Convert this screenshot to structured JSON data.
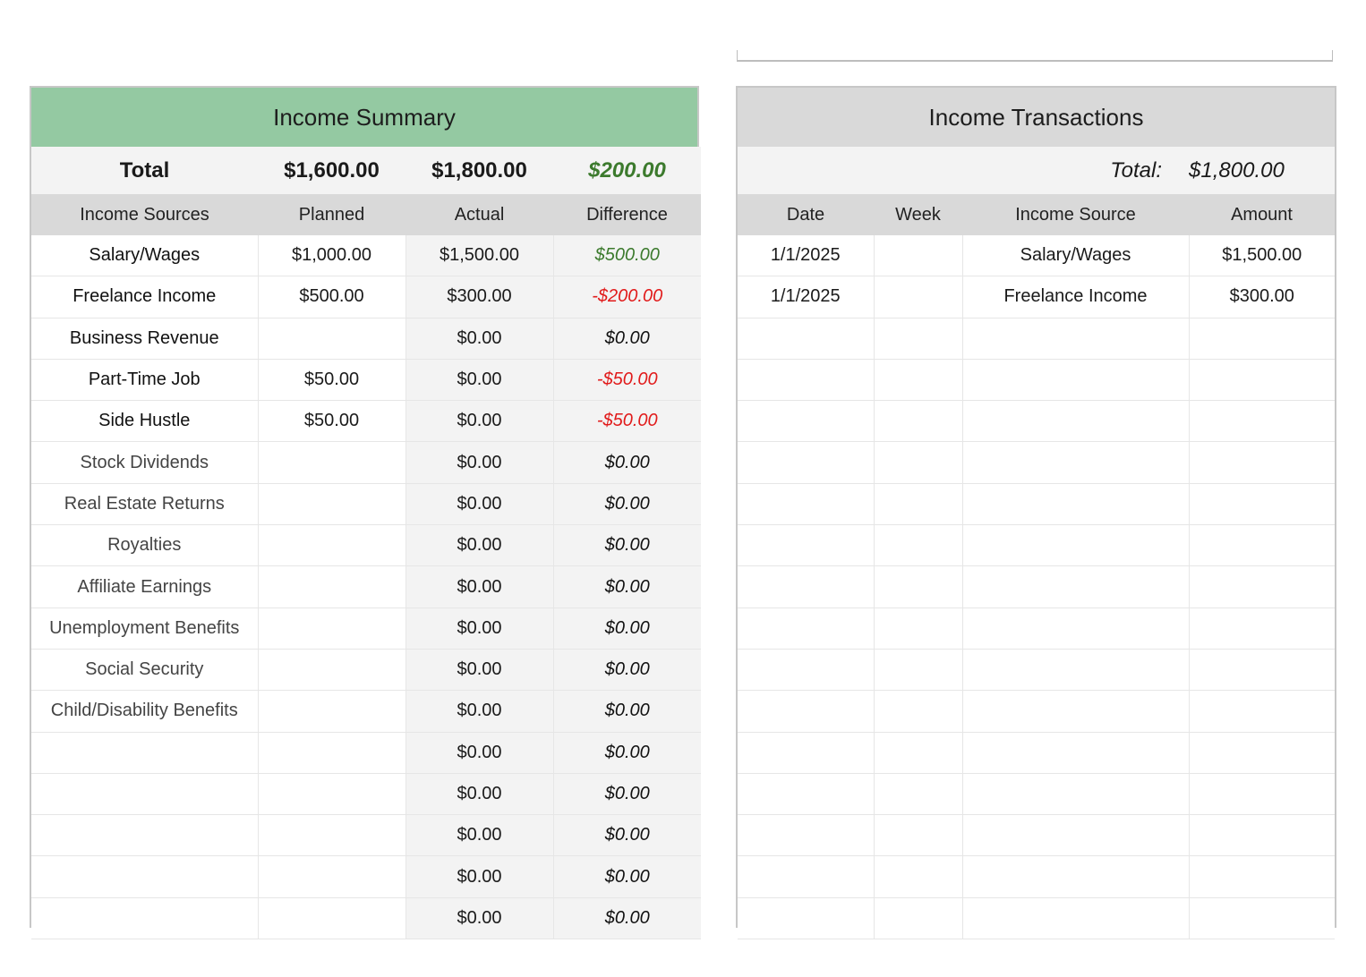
{
  "summary": {
    "title": "Income Summary",
    "totals": {
      "label": "Total",
      "planned": "$1,600.00",
      "actual": "$1,800.00",
      "difference": "$200.00"
    },
    "headers": [
      "Income Sources",
      "Planned",
      "Actual",
      "Difference"
    ],
    "rows": [
      {
        "source": "Salary/Wages",
        "planned": "$1,000.00",
        "actual": "$1,500.00",
        "difference": "$500.00",
        "sign": "pos"
      },
      {
        "source": "Freelance Income",
        "planned": "$500.00",
        "actual": "$300.00",
        "difference": "-$200.00",
        "sign": "neg"
      },
      {
        "source": "Business Revenue",
        "planned": "",
        "actual": "$0.00",
        "difference": "$0.00",
        "sign": "zero"
      },
      {
        "source": "Part-Time Job",
        "planned": "$50.00",
        "actual": "$0.00",
        "difference": "-$50.00",
        "sign": "neg"
      },
      {
        "source": "Side Hustle",
        "planned": "$50.00",
        "actual": "$0.00",
        "difference": "-$50.00",
        "sign": "neg"
      },
      {
        "source": "Stock Dividends",
        "planned": "",
        "actual": "$0.00",
        "difference": "$0.00",
        "sign": "zero"
      },
      {
        "source": "Real Estate Returns",
        "planned": "",
        "actual": "$0.00",
        "difference": "$0.00",
        "sign": "zero"
      },
      {
        "source": "Royalties",
        "planned": "",
        "actual": "$0.00",
        "difference": "$0.00",
        "sign": "zero"
      },
      {
        "source": "Affiliate Earnings",
        "planned": "",
        "actual": "$0.00",
        "difference": "$0.00",
        "sign": "zero"
      },
      {
        "source": "Unemployment Benefits",
        "planned": "",
        "actual": "$0.00",
        "difference": "$0.00",
        "sign": "zero"
      },
      {
        "source": "Social Security",
        "planned": "",
        "actual": "$0.00",
        "difference": "$0.00",
        "sign": "zero"
      },
      {
        "source": "Child/Disability Benefits",
        "planned": "",
        "actual": "$0.00",
        "difference": "$0.00",
        "sign": "zero"
      },
      {
        "source": "",
        "planned": "",
        "actual": "$0.00",
        "difference": "$0.00",
        "sign": "zero"
      },
      {
        "source": "",
        "planned": "",
        "actual": "$0.00",
        "difference": "$0.00",
        "sign": "zero"
      },
      {
        "source": "",
        "planned": "",
        "actual": "$0.00",
        "difference": "$0.00",
        "sign": "zero"
      },
      {
        "source": "",
        "planned": "",
        "actual": "$0.00",
        "difference": "$0.00",
        "sign": "zero"
      },
      {
        "source": "",
        "planned": "",
        "actual": "$0.00",
        "difference": "$0.00",
        "sign": "zero"
      }
    ]
  },
  "transactions": {
    "title": "Income Transactions",
    "total_label": "Total:",
    "total_value": "$1,800.00",
    "headers": [
      "Date",
      "Week",
      "Income Source",
      "Amount"
    ],
    "rows": [
      {
        "date": "1/1/2025",
        "week": "",
        "source": "Salary/Wages",
        "amount": "$1,500.00"
      },
      {
        "date": "1/1/2025",
        "week": "",
        "source": "Freelance Income",
        "amount": "$300.00"
      },
      {
        "date": "",
        "week": "",
        "source": "",
        "amount": ""
      },
      {
        "date": "",
        "week": "",
        "source": "",
        "amount": ""
      },
      {
        "date": "",
        "week": "",
        "source": "",
        "amount": ""
      },
      {
        "date": "",
        "week": "",
        "source": "",
        "amount": ""
      },
      {
        "date": "",
        "week": "",
        "source": "",
        "amount": ""
      },
      {
        "date": "",
        "week": "",
        "source": "",
        "amount": ""
      },
      {
        "date": "",
        "week": "",
        "source": "",
        "amount": ""
      },
      {
        "date": "",
        "week": "",
        "source": "",
        "amount": ""
      },
      {
        "date": "",
        "week": "",
        "source": "",
        "amount": ""
      },
      {
        "date": "",
        "week": "",
        "source": "",
        "amount": ""
      },
      {
        "date": "",
        "week": "",
        "source": "",
        "amount": ""
      },
      {
        "date": "",
        "week": "",
        "source": "",
        "amount": ""
      },
      {
        "date": "",
        "week": "",
        "source": "",
        "amount": ""
      },
      {
        "date": "",
        "week": "",
        "source": "",
        "amount": ""
      },
      {
        "date": "",
        "week": "",
        "source": "",
        "amount": ""
      }
    ]
  },
  "colors": {
    "summary_header": "#94c9a2",
    "transactions_header": "#d9d9d9",
    "positive": "#3c7a2d",
    "negative": "#e11b1b"
  }
}
